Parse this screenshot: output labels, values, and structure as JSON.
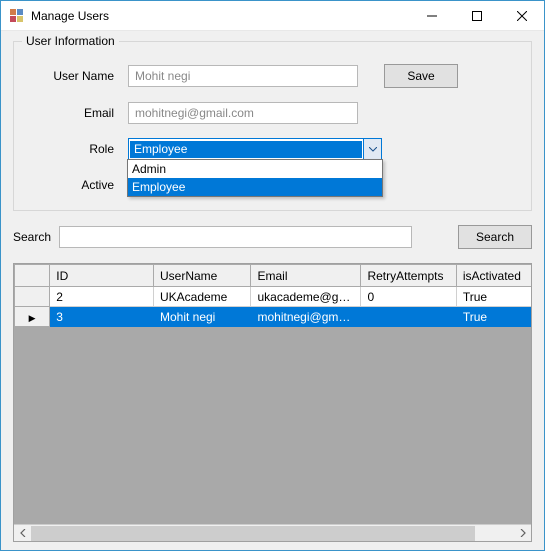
{
  "window": {
    "title": "Manage Users"
  },
  "group": {
    "title": "User Information",
    "labels": {
      "username": "User Name",
      "email": "Email",
      "role": "Role",
      "active": "Active"
    },
    "values": {
      "username": "Mohit negi",
      "email": "mohitnegi@gmail.com",
      "role_selected": "Employee"
    },
    "role_options": [
      "Admin",
      "Employee"
    ],
    "save_label": "Save"
  },
  "search": {
    "label": "Search",
    "value": "",
    "button": "Search"
  },
  "grid": {
    "columns": [
      "ID",
      "UserName",
      "Email",
      "RetryAttempts",
      "isActivated"
    ],
    "rows": [
      {
        "selected": false,
        "indicator": "",
        "cells": [
          "2",
          "UKAcademe",
          "ukacademe@gm...",
          "0",
          "True"
        ]
      },
      {
        "selected": true,
        "indicator": "▶",
        "cells": [
          "3",
          "Mohit negi",
          "mohitnegi@gmail....",
          "",
          "True"
        ]
      }
    ]
  }
}
